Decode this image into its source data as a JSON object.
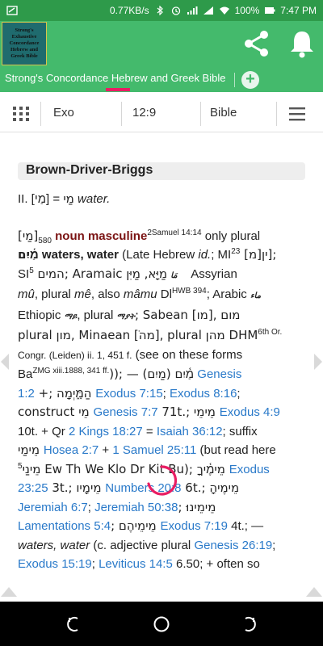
{
  "status_bar": {
    "network_speed": "0.77KB/s",
    "battery": "100%",
    "time": "7:47 PM"
  },
  "app": {
    "logo_lines": [
      "Strong's",
      "Exhaustive",
      "Concordance",
      "Hebrew and",
      "Greek Bible"
    ],
    "tab_title": "Strong's  Concordance Hebrew and Greek Bible",
    "add_tab": "+"
  },
  "toolbar": {
    "book": "Exo",
    "chapter_verse": "12:9",
    "version": "Bible"
  },
  "content": {
    "section_title": "Brown-Driver-Briggs",
    "lines": {
      "l1a": "II. [מַי] = ",
      "l1b": "מַי",
      "l1c": " water.",
      "l2a": "[מַי]",
      "l2b": "580",
      "l2c": " noun masculine",
      "l2d": "2Samuel 14:14",
      "l2e": " only plural",
      "l3a": "מַ֫יִם",
      "l3b": " waters, water",
      "l3c": " (Late Hebrew ",
      "l3d": "id.",
      "l3e": "; MI",
      "l3f": "23",
      "l3g": " [מ]ין];",
      "l4a": "SI",
      "l4b": "5",
      "l4c": " המים; Aramaic ",
      "l4d": "מַיָּא, מַיִּן",
      "l4e": "    Assyrian",
      "l5a": "mû",
      "l5b": ", plural ",
      "l5c": "mê",
      "l5d": ", also ",
      "l5e": "mâmu",
      "l5f": " Dl",
      "l5g": "HWB 394",
      "l5h": "; Arabic",
      "l6a": "Ethiopic ",
      "l6b": ", plural ",
      "l6c": "; Sabean [מו], מום",
      "l7a": "plural מון, Minaean [מהֹ], plural מהן DHM",
      "l7b": "6th Or.",
      "l8a": "Congr. (Leiden) ii. 1, 451 f.",
      "l8b": " (see on these forms",
      "l9a": "Ba",
      "l9b": "ZMG xiii.1888, 341 ff.",
      "l9c": ")); — (מַיִם) ",
      "l9d": "מַ֫יִם",
      "l9e": " Genesis",
      "l10a": "1:2",
      "l10b": " +; הַמָּ֑יְמָה ",
      "l10c": "Exodus 7:15",
      "l10d": "; ",
      "l10e": "Exodus 8:16",
      "l10f": ";",
      "l11a": "construct מֵי ",
      "l11b": "Genesis 7:7",
      "l11c": " 71t.; מֵימֵי ",
      "l11d": "Exodus 4:9",
      "l12a": "10t. + Qr ",
      "l12b": "2 Kings 18:27",
      "l12c": " = ",
      "l12d": "Isaiah 36:12",
      "l12e": "; suffix",
      "l13a": "מֵימַי ",
      "l13b": "Hosea 2:7",
      "l13c": " + ",
      "l13d": "1 Samuel 25:11",
      "l13e": " (but read here",
      "l14a": "מֵינַי",
      "l14b": "5",
      "l14c": " Ew Th We Klo Dr Kit Bu); מֵימֶ֫יךָ ",
      "l14d": "Exodus",
      "l15a": "23:25",
      "l15b": " 3t.; מֵימָיו ",
      "l15c": "Numbers 20:8",
      "l15d": " 6t.; מֵימֶיהָ",
      "l16a": "Jeremiah 6:7",
      "l16b": "; ",
      "l16c": "Jeremiah 50:38",
      "l16d": "; מֵימֵינוּ",
      "l17a": "Lamentations 5:4",
      "l17b": "; מֵימֵיהֶם ",
      "l17c": "Exodus 7:19",
      "l17d": " 4t.; —",
      "l18a": "waters, water",
      "l18b": " (c. adjective plural ",
      "l18c": "Genesis 26:19",
      "l18d": ";",
      "l19a": "Exodus 15:19",
      "l19b": "; ",
      "l19c": "Leviticus 14:5",
      "l19d": " 6.50; + often so"
    }
  },
  "colors": {
    "status_bar": "#2e9a4a",
    "app_bar": "#44ba6c",
    "tab_indicator": "#e91e63",
    "link": "#2979c9",
    "part_of_speech": "#7a1212"
  },
  "icons": [
    "share-icon",
    "bell-icon",
    "grid-icon",
    "menu-icon",
    "add-tab-icon",
    "back-icon",
    "home-icon",
    "recents-icon"
  ]
}
